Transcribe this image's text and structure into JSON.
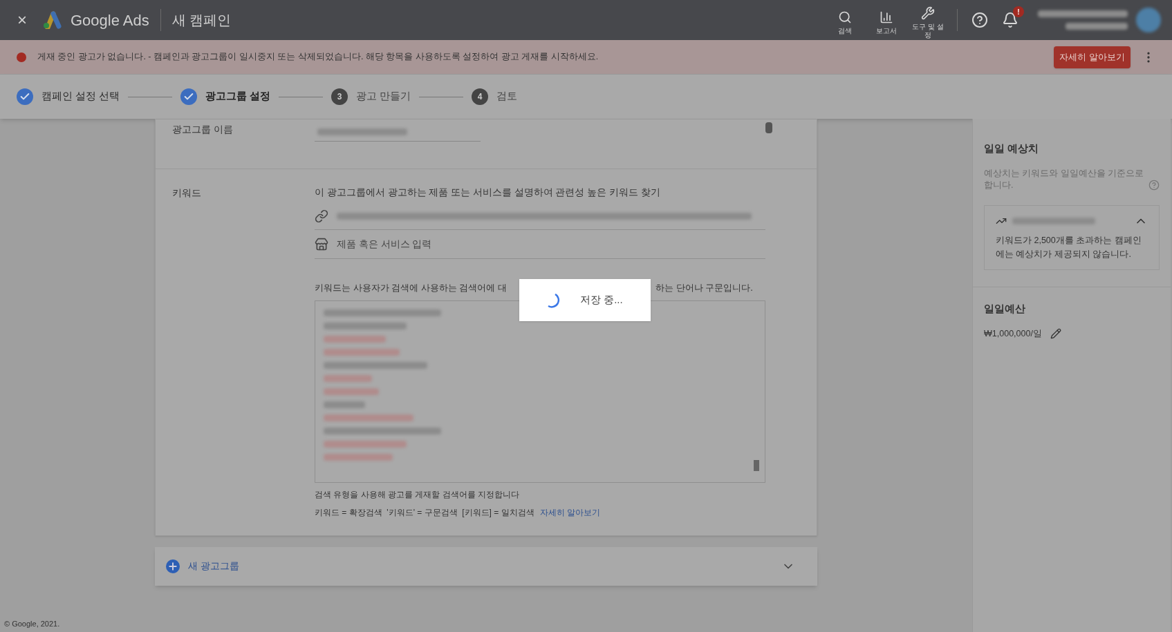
{
  "header": {
    "close": "×",
    "product": "Google Ads",
    "title": "새 캠페인",
    "tools": [
      {
        "kind": "search",
        "label": "검색"
      },
      {
        "kind": "reports",
        "label": "보고서"
      },
      {
        "kind": "tools",
        "label": "도구 및 설정"
      }
    ],
    "notification_badge": "!"
  },
  "banner": {
    "message": "게재 중인 광고가 없습니다. - 캠페인과 광고그룹이 일시중지 또는 삭제되었습니다. 해당 항목을 사용하도록 설정하여 광고 게재를 시작하세요.",
    "button": "자세히 알아보기"
  },
  "steps": [
    {
      "label": "캠페인 설정 선택",
      "done": true,
      "current": false
    },
    {
      "label": "광고그룹 설정",
      "done": true,
      "current": true
    },
    {
      "number": "3",
      "label": "광고 만들기",
      "done": false,
      "current": false
    },
    {
      "number": "4",
      "label": "검토",
      "done": false,
      "current": false
    }
  ],
  "ad_group": {
    "name_label": "광고그룹 이름"
  },
  "keywords": {
    "label": "키워드",
    "hint": "이 광고그룹에서 광고하는 제품 또는 서비스를 설명하여 관련성 높은 키워드 찾기",
    "product_placeholder": "제품 혹은 서비스 입력",
    "description_before": "키워드는 사용자가 검색에 사용하는 검색어에 대",
    "description_after": "하는 단어나 구문입니다.",
    "match_hint": "검색 유형을 사용해 광고를 게재할 검색어를 지정합니다",
    "match_types": "키워드 = 확장검색  '키워드' = 구문검색  [키워드] = 일치검색",
    "learn_more": "자세히 알아보기"
  },
  "new_ad_group": "새 광고그룹",
  "footer": "© Google, 2021.",
  "sidebar": {
    "estimates_title": "일일 예상치",
    "estimates_note": "예상치는 키워드와 일일예산을 기준으로 합니다.",
    "estimates_card_text": "키워드가 2,500개를 초과하는 캠페인에는 예상치가 제공되지 않습니다.",
    "budget_title": "일일예산",
    "budget_value": "₩1,000,000/일"
  },
  "dialog": {
    "text": "저장 중..."
  }
}
